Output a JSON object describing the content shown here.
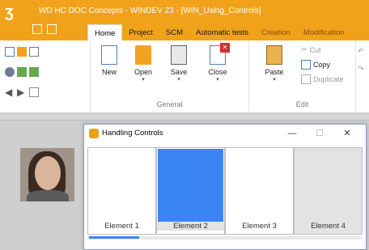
{
  "window": {
    "title": "WD HC DOC Concepts - WINDEV 23 - [WIN_Using_Controls]",
    "accent_color": "#f0a21b"
  },
  "tabs": [
    {
      "label": "Home",
      "active": true
    },
    {
      "label": "Project"
    },
    {
      "label": "SCM"
    },
    {
      "label": "Automatic tests"
    },
    {
      "label": "Creation"
    },
    {
      "label": "Modification"
    }
  ],
  "ribbon": {
    "general": {
      "label": "General",
      "buttons": [
        {
          "label": "New",
          "icon": "new-document-icon"
        },
        {
          "label": "Open",
          "icon": "open-folder-icon"
        },
        {
          "label": "Save",
          "icon": "save-disk-icon"
        },
        {
          "label": "Close",
          "icon": "close-document-icon"
        }
      ]
    },
    "edit": {
      "label": "Edit",
      "paste": "Paste",
      "cut": "Cut",
      "copy": "Copy",
      "duplicate": "Duplicate"
    }
  },
  "dialog": {
    "title": "Handling Controls",
    "minimize": "—",
    "maximize": "☐",
    "close": "✕",
    "elements": [
      {
        "label": "Element 1",
        "state": "normal"
      },
      {
        "label": "Element 2",
        "state": "selected"
      },
      {
        "label": "Element 3",
        "state": "normal"
      },
      {
        "label": "Element 4",
        "state": "grey"
      }
    ],
    "selected_color": "#3b84f5"
  }
}
